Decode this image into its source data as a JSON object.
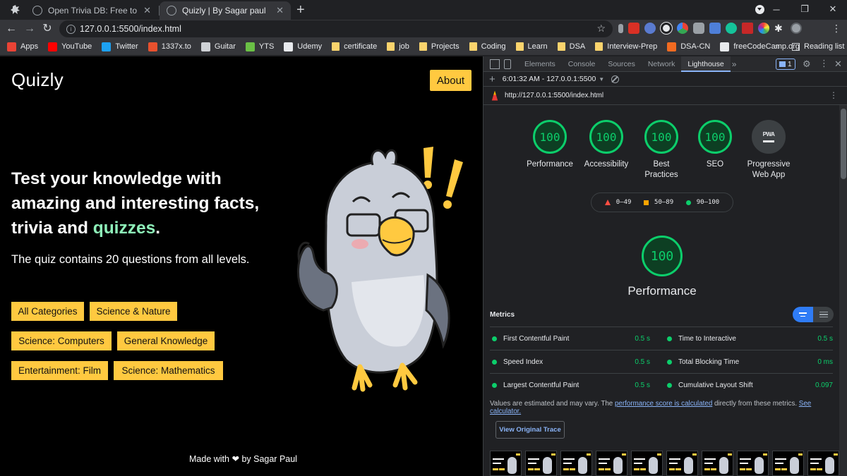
{
  "browser": {
    "tabs": [
      {
        "label": "Open Trivia DB: Free to use, user-contributed trivia question database.",
        "active": false
      },
      {
        "label": "Quizly | By Sagar paul",
        "active": true
      }
    ],
    "url": "127.0.0.1:5500/index.html",
    "bookmarks": [
      {
        "label": "Apps",
        "icon": "apps-grid-icon",
        "color": "#ea4335"
      },
      {
        "label": "YouTube",
        "icon": "youtube-icon",
        "color": "#ff0000"
      },
      {
        "label": "Twitter",
        "icon": "twitter-icon",
        "color": "#1da1f2"
      },
      {
        "label": "1337x.to",
        "icon": "x-icon",
        "color": "#e8512e"
      },
      {
        "label": "Guitar",
        "icon": "guitar-icon",
        "color": "#cfd2d6"
      },
      {
        "label": "YTS",
        "icon": "yts-icon",
        "color": "#6ac045"
      },
      {
        "label": "Udemy",
        "icon": "udemy-icon",
        "color": "#e8eaed"
      },
      {
        "label": "certificate",
        "icon": "folder-icon",
        "color": "#fbd46d"
      },
      {
        "label": "job",
        "icon": "folder-icon",
        "color": "#fbd46d"
      },
      {
        "label": "Projects",
        "icon": "folder-icon",
        "color": "#fbd46d"
      },
      {
        "label": "Coding",
        "icon": "folder-icon",
        "color": "#fbd46d"
      },
      {
        "label": "Learn",
        "icon": "folder-icon",
        "color": "#fbd46d"
      },
      {
        "label": "DSA",
        "icon": "folder-icon",
        "color": "#fbd46d"
      },
      {
        "label": "Interview-Prep",
        "icon": "folder-icon",
        "color": "#fbd46d"
      },
      {
        "label": "DSA-CN",
        "icon": "cn-icon",
        "color": "#f26b21"
      },
      {
        "label": "freeCodeCamp.org",
        "icon": "freecodecamp-icon",
        "color": "#e8eaed"
      }
    ],
    "bookmarks_more": "»",
    "reading_list": "Reading list"
  },
  "page": {
    "logo": "Quizly",
    "about": "About",
    "hero_line1": "Test your knowledge with amazing and interesting facts, trivia and ",
    "hero_accent": "quizzes",
    "hero_end": ".",
    "subtitle": "The quiz contains 20 questions from all levels.",
    "categories": [
      "All Categories",
      "Science & Nature",
      "Science: Computers",
      "General Knowledge",
      "Entertainment: Film",
      "Science: Mathematics"
    ],
    "footer_pre": "Made with",
    "footer_post": "by Sagar Paul",
    "colors": {
      "accent": "#ffc940",
      "highlight": "#8ef0b9"
    }
  },
  "devtools": {
    "tabs": [
      "Elements",
      "Console",
      "Sources",
      "Network",
      "Lighthouse"
    ],
    "more_tabs": "»",
    "issues_count": "1",
    "report_time": "6:01:32 AM - 127.0.0.1:5500",
    "report_url": "http://127.0.0.1:5500/index.html",
    "gauges": [
      {
        "score": "100",
        "label": "Performance"
      },
      {
        "score": "100",
        "label": "Accessibility"
      },
      {
        "score": "100",
        "label": "Best Practices"
      },
      {
        "score": "100",
        "label": "SEO"
      },
      {
        "score": "PWA",
        "label": "Progressive Web App"
      }
    ],
    "legend": [
      "0–49",
      "50–89",
      "90–100"
    ],
    "perf_score": "100",
    "perf_title": "Performance",
    "metrics_title": "Metrics",
    "metrics": [
      {
        "name": "First Contentful Paint",
        "value": "0.5 s"
      },
      {
        "name": "Time to Interactive",
        "value": "0.5 s"
      },
      {
        "name": "Speed Index",
        "value": "0.5 s"
      },
      {
        "name": "Total Blocking Time",
        "value": "0 ms"
      },
      {
        "name": "Largest Contentful Paint",
        "value": "0.5 s"
      },
      {
        "name": "Cumulative Layout Shift",
        "value": "0.097"
      }
    ],
    "note_pre": "Values are estimated and may vary. The ",
    "note_link1": "performance score is calculated",
    "note_mid": " directly from these metrics. ",
    "note_link2": "See calculator.",
    "trace_button": "View Original Trace",
    "colors": {
      "pass": "#0cce6b",
      "average": "#ffa400",
      "fail": "#ff4e42"
    }
  }
}
